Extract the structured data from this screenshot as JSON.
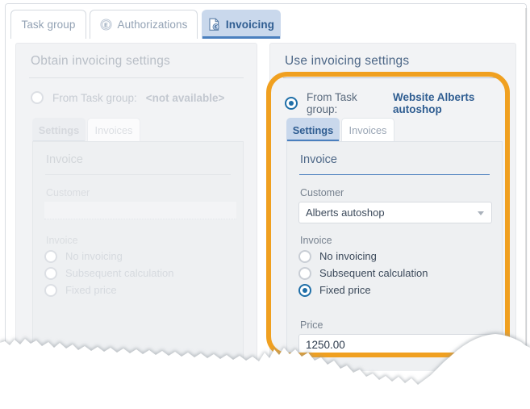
{
  "window": {
    "tabs": [
      {
        "label": "Task group",
        "icon": "none",
        "active": false
      },
      {
        "label": "Authorizations",
        "icon": "circled-e-icon",
        "active": false
      },
      {
        "label": "Invoicing",
        "icon": "invoice-document-euro-icon",
        "active": true
      }
    ]
  },
  "left_panel": {
    "title": "Obtain invoicing settings",
    "source": {
      "prefix": "From Task group:",
      "value": "<not available>",
      "selected": false
    },
    "inner_tabs": [
      {
        "label": "Settings",
        "active": true
      },
      {
        "label": "Invoices",
        "active": false
      }
    ],
    "section_title": "Invoice",
    "customer": {
      "label": "Customer",
      "value": ""
    },
    "invoice": {
      "label": "Invoice",
      "options": [
        {
          "label": "No invoicing",
          "selected": false
        },
        {
          "label": "Subsequent calculation",
          "selected": false
        },
        {
          "label": "Fixed price",
          "selected": false
        }
      ]
    }
  },
  "right_panel": {
    "title": "Use invoicing settings",
    "source": {
      "prefix": "From Task group:",
      "value": "Website Alberts autoshop",
      "selected": true
    },
    "inner_tabs": [
      {
        "label": "Settings",
        "active": true
      },
      {
        "label": "Invoices",
        "active": false
      }
    ],
    "section_title": "Invoice",
    "customer": {
      "label": "Customer",
      "value": "Alberts autoshop"
    },
    "invoice": {
      "label": "Invoice",
      "options": [
        {
          "label": "No invoicing",
          "selected": false
        },
        {
          "label": "Subsequent calculation",
          "selected": false
        },
        {
          "label": "Fixed price",
          "selected": true
        }
      ]
    },
    "price": {
      "label": "Price",
      "value": "1250.00"
    }
  },
  "colors": {
    "highlight_ring": "#F0A020",
    "accent_blue": "#4a7fbe",
    "active_tab_bg": "#c9d8ec",
    "heading_blue": "#4d6787",
    "panel_bg": "#f2f3f5"
  }
}
